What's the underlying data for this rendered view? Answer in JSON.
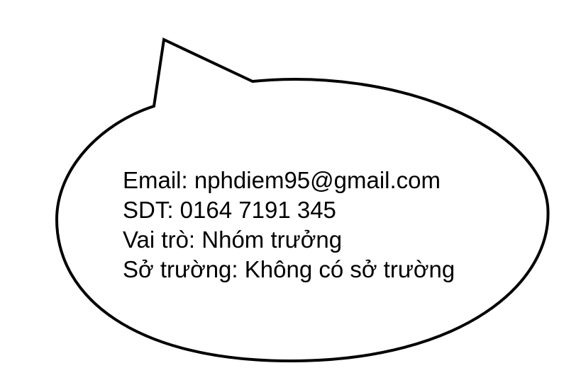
{
  "bubble": {
    "stroke_color": "#000000",
    "fill_color": "#ffffff"
  },
  "lines": [
    "Email: nphdiem95@gmail.com",
    "SDT: 0164 7191 345",
    "Vai trò: Nhóm trưởng",
    "Sở trường: Không có sở trường"
  ]
}
